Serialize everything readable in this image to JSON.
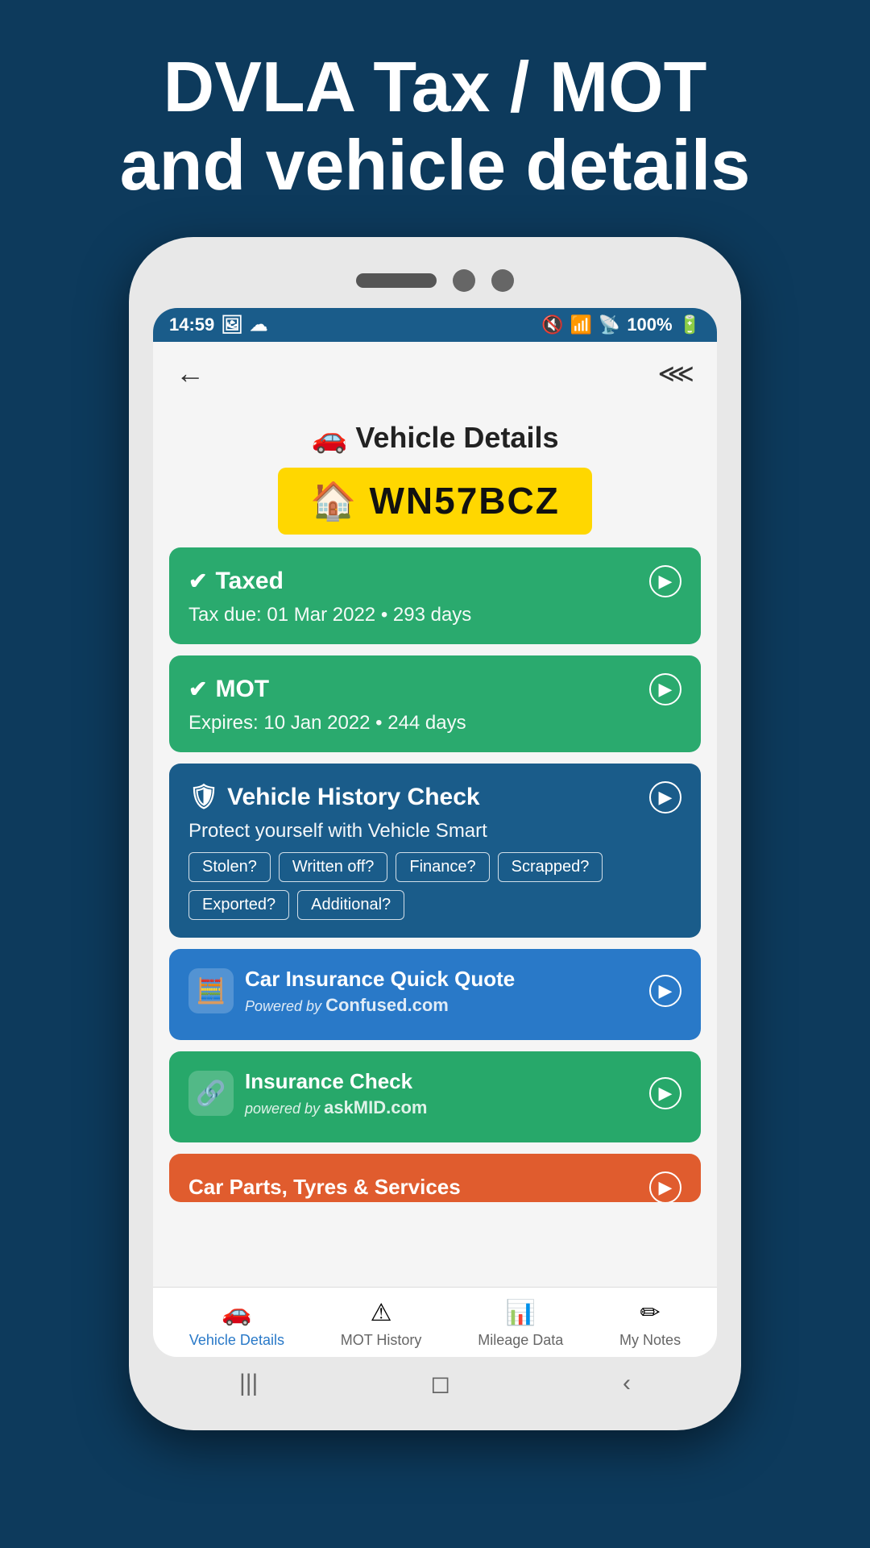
{
  "page": {
    "header_line1": "DVLA Tax / MOT",
    "header_line2": "and vehicle details"
  },
  "status_bar": {
    "time": "14:59",
    "battery": "100%",
    "signal": "📶",
    "wifi": "📡"
  },
  "toolbar": {
    "back_label": "←",
    "share_label": "⋮"
  },
  "vehicle": {
    "page_title": "🚗 Vehicle Details",
    "plate_icon": "🏠",
    "plate_number": "WN57BCZ"
  },
  "tax_card": {
    "title": "Taxed",
    "subtitle": "Tax due: 01 Mar 2022 • 293 days"
  },
  "mot_card": {
    "title": "MOT",
    "subtitle": "Expires: 10 Jan 2022 • 244 days"
  },
  "history_card": {
    "title": "Vehicle History Check",
    "description": "Protect yourself with Vehicle Smart",
    "badges": [
      "Stolen?",
      "Written off?",
      "Finance?",
      "Scrapped?",
      "Exported?",
      "Additional?"
    ]
  },
  "insurance_quote_card": {
    "title": "Car Insurance Quick Quote",
    "powered_by": "Powered by",
    "brand": "Confused.com"
  },
  "insurance_check_card": {
    "title": "Insurance Check",
    "powered_by": "powered by",
    "brand": "askMID.com"
  },
  "car_parts_card": {
    "title": "Car Parts, Tyres & Services"
  },
  "bottom_nav": {
    "items": [
      {
        "label": "Vehicle Details",
        "active": true,
        "icon": "🚗"
      },
      {
        "label": "MOT History",
        "active": false,
        "icon": "⚠"
      },
      {
        "label": "Mileage Data",
        "active": false,
        "icon": "📊"
      },
      {
        "label": "My Notes",
        "active": false,
        "icon": "✏"
      }
    ]
  },
  "phone_nav": {
    "back": "‹",
    "home": "◻",
    "recent": "|||"
  }
}
